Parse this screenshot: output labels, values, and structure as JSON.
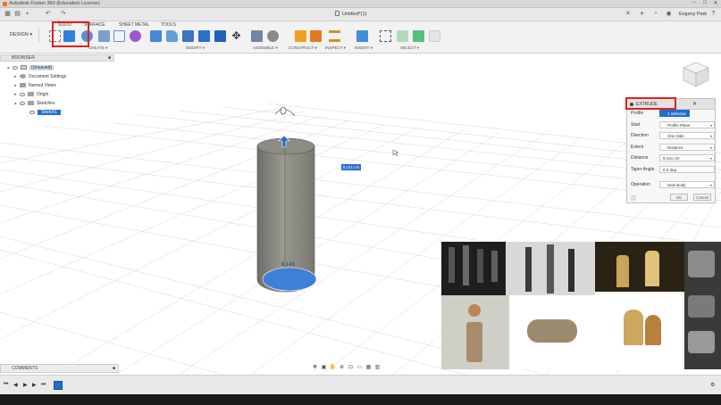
{
  "window": {
    "title": "Autodesk Fusion 360 (Education License)",
    "controls": [
      "–",
      "□",
      "✕"
    ]
  },
  "tabbar": {
    "document_title": "Untitled*(1)",
    "user": "Evgeny Park"
  },
  "toolbar": {
    "workspace": "DESIGN ▾",
    "tabs": [
      "SOLID",
      "SURFACE",
      "SHEET METAL",
      "TOOLS"
    ],
    "groups": [
      "CREATE ▾",
      "MODIFY ▾",
      "ASSEMBLE ▾",
      "CONSTRUCT ▾",
      "INSPECT ▾",
      "INSERT ▾",
      "SELECT ▾"
    ]
  },
  "browser": {
    "header": "BROWSER",
    "items": [
      {
        "label": "(Unsaved)"
      },
      {
        "label": "Document Settings"
      },
      {
        "label": "Named Views"
      },
      {
        "label": "Origin"
      },
      {
        "label": "Sketches"
      },
      {
        "label": "Sketch1"
      }
    ]
  },
  "extrude": {
    "title": "EXTRUDE",
    "rows": [
      {
        "label": "Profile",
        "value": "1 selected"
      },
      {
        "label": "Start",
        "value": "Profile Plane"
      },
      {
        "label": "Direction",
        "value": "One Side"
      },
      {
        "label": "Extent",
        "value": "Distance"
      },
      {
        "label": "Distance",
        "value": "9.141 cm"
      },
      {
        "label": "Taper Angle",
        "value": "0.0 deg"
      },
      {
        "label": "Operation",
        "value": "New Body"
      }
    ],
    "ok": "OK",
    "cancel": "Cancel"
  },
  "viewport": {
    "distance_input": "9.141 cm",
    "dimension_label": "9.141"
  },
  "comments": {
    "label": "COMMENTS"
  },
  "colors": {
    "accent": "#1f6fc9",
    "highlight": "#e02020",
    "cylinder": "#8b8b84",
    "profile": "#3f7fd6"
  }
}
